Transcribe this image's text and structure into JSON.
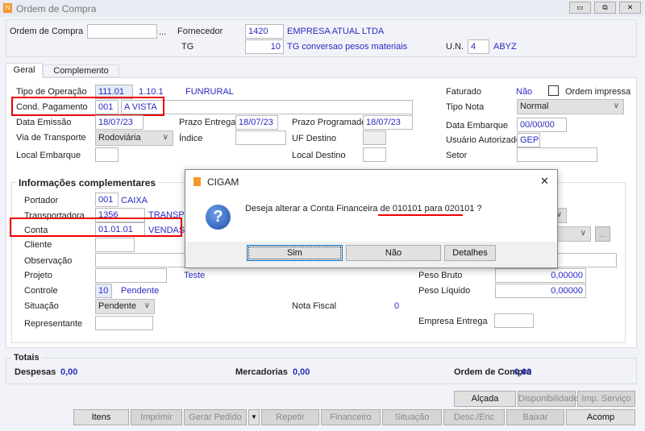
{
  "window": {
    "title": "Ordem de Compra",
    "minimize": "▭",
    "restore": "⧉",
    "close": "✕"
  },
  "header": {
    "ordem_label": "Ordem de Compra",
    "ordem_value": "",
    "ellipsis": "...",
    "fornecedor_label": "Fornecedor",
    "fornecedor_code": "1420",
    "fornecedor_name": "EMPRESA ATUAL LTDA",
    "tg_label": "TG",
    "tg_code": "10",
    "tg_desc": "TG conversao pesos materiais",
    "un_label": "U.N.",
    "un_code": "4",
    "un_desc": "ABYZ"
  },
  "tabs": [
    {
      "label": "Geral"
    },
    {
      "label": "Complemento"
    }
  ],
  "geral": {
    "tipo_op_label": "Tipo de Operação",
    "tipo_op_code": "111.01",
    "tipo_op_num": "1.10.1",
    "tipo_op_desc": "FUNRURAL",
    "cond_label": "Cond. Pagamento",
    "cond_code": "001",
    "cond_desc": "A VISTA",
    "data_emissao_label": "Data Emissão",
    "data_emissao": "18/07/23",
    "prazo_entrega_label": "Prazo Entrega",
    "prazo_entrega": "18/07/23",
    "prazo_prog_label": "Prazo Programado",
    "prazo_prog": "18/07/23",
    "via_label": "Via de Transporte",
    "via_value": "Rodoviária",
    "indice_label": "Índice",
    "uf_label": "UF Destino",
    "local_emb_label": "Local Embarque",
    "local_dest_label": "Local Destino",
    "faturado_label": "Faturado",
    "faturado_value": "Não",
    "ordem_impressa_label": "Ordem impressa",
    "tipo_nota_label": "Tipo Nota",
    "tipo_nota_value": "Normal",
    "data_emb_label": "Data Embarque",
    "data_emb": "00/00/00",
    "usuario_label": "Usuário Autorizado",
    "usuario_value": "GEP",
    "setor_label": "Setor"
  },
  "info": {
    "title": "Informações complementares",
    "portador_label": "Portador",
    "portador_code": "001",
    "portador_desc": "CAIXA",
    "transp_label": "Transportadora",
    "transp_code": "1356",
    "transp_desc": "TRANSPO",
    "conta_label": "Conta",
    "conta_code": "01.01.01",
    "conta_desc": "VENDAS",
    "cliente_label": "Cliente",
    "obs_label": "Observação",
    "projeto_label": "Projeto",
    "projeto_desc": "Teste",
    "controle_label": "Controle",
    "controle_code": "10",
    "controle_desc": "Pendente",
    "situacao_label": "Situação",
    "situacao_value": "Pendente",
    "nota_label": "Nota Fiscal",
    "nota_value": "0",
    "repr_label": "Representante",
    "peso_bruto_label": "Peso Bruto",
    "peso_bruto": "0,00000",
    "peso_liq_label": "Peso Líquido",
    "peso_liq": "0,00000",
    "empresa_label": "Empresa Entrega",
    "more": "..."
  },
  "totais": {
    "title": "Totais",
    "despesas_label": "Despesas",
    "despesas": "0,00",
    "merc_label": "Mercadorias",
    "merc": "0,00",
    "oc_label": "Ordem de Compra",
    "oc": "0,00"
  },
  "buttons_top": [
    "Alçada",
    "Disponibilidade",
    "Imp. Serviço"
  ],
  "buttons_bottom": [
    "Itens",
    "Imprimir",
    "Gerar Pedido",
    "Repetir",
    "Financeiro",
    "Situação",
    "Desc./Enc",
    "Baixar",
    "Acomp"
  ],
  "dialog": {
    "title": "CIGAM",
    "close": "✕",
    "message": "Deseja alterar a Conta Financeira de 010101 para 020101 ?",
    "sim": "Sim",
    "nao": "Não",
    "detalhes": "Detalhes"
  }
}
